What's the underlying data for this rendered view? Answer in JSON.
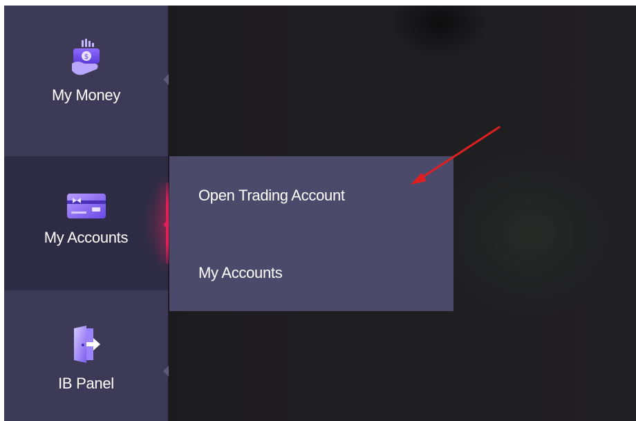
{
  "sidebar": {
    "items": [
      {
        "label": "My Money",
        "icon": "money-hand-icon",
        "active": false
      },
      {
        "label": "My Accounts",
        "icon": "accounts-card-icon",
        "active": true
      },
      {
        "label": "IB Panel",
        "icon": "door-exit-icon",
        "active": false
      }
    ]
  },
  "submenu": {
    "items": [
      {
        "label": "Open Trading Account"
      },
      {
        "label": "My Accounts"
      }
    ]
  },
  "colors": {
    "sidebar_bg": "#3c3a56",
    "sidebar_active_bg": "#2e2c45",
    "submenu_bg": "#4b4a6b",
    "active_indicator": "#e0205a",
    "annotation_arrow": "#e02020",
    "icon_purple": "#7b5cf0"
  }
}
